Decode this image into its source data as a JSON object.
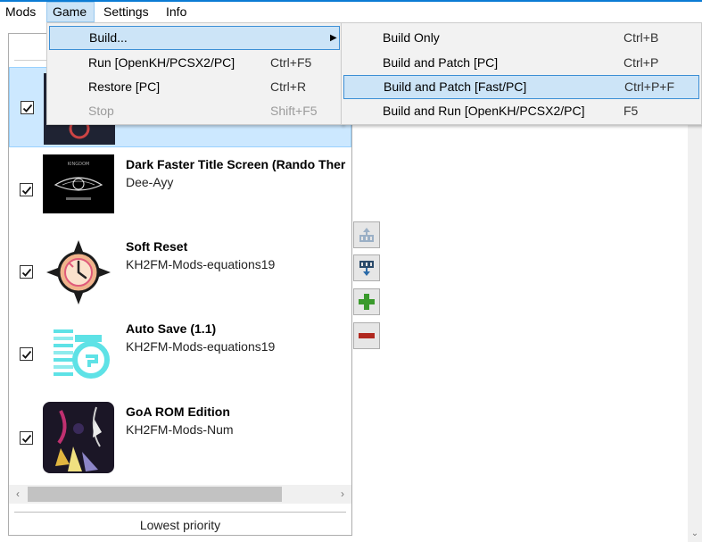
{
  "menubar": {
    "items": [
      {
        "label": "Mods"
      },
      {
        "label": "Game"
      },
      {
        "label": "Settings"
      },
      {
        "label": "Info"
      }
    ],
    "active": "Game"
  },
  "game_menu": {
    "items": [
      {
        "label": "Build...",
        "shortcut": "",
        "has_submenu": true,
        "highlighted": true,
        "enabled": true
      },
      {
        "label": "Run [OpenKH/PCSX2/PC]",
        "shortcut": "Ctrl+F5",
        "enabled": true
      },
      {
        "label": "Restore [PC]",
        "shortcut": "Ctrl+R",
        "enabled": true
      },
      {
        "label": "Stop",
        "shortcut": "Shift+F5",
        "enabled": false
      }
    ]
  },
  "build_submenu": {
    "items": [
      {
        "label": "Build Only",
        "shortcut": "Ctrl+B"
      },
      {
        "label": "Build and Patch [PC]",
        "shortcut": "Ctrl+P"
      },
      {
        "label": "Build and Patch [Fast/PC]",
        "shortcut": "Ctrl+P+F",
        "highlighted": true
      },
      {
        "label": "Build and Run [OpenKH/PCSX2/PC]",
        "shortcut": "F5"
      }
    ]
  },
  "mods": [
    {
      "title": "",
      "author": "",
      "checked": true,
      "selected": true
    },
    {
      "title": "Dark Faster Title Screen (Rando Ther",
      "author": "Dee-Ayy",
      "checked": true
    },
    {
      "title": "Soft Reset",
      "author": "KH2FM-Mods-equations19",
      "checked": true
    },
    {
      "title": "Auto Save (1.1)",
      "author": "KH2FM-Mods-equations19",
      "checked": true
    },
    {
      "title": "GoA ROM Edition",
      "author": "KH2FM-Mods-Num",
      "checked": true
    }
  ],
  "list_footer": {
    "label": "Lowest priority"
  },
  "side_buttons": [
    "move-up-icon",
    "move-down-icon",
    "add-icon",
    "remove-icon"
  ],
  "colors": {
    "accent": "#0b7bd4",
    "selection": "#cce8ff",
    "menu_highlight": "#cce4f7",
    "add_green": "#3a9a2c",
    "remove_red": "#b0281f"
  }
}
